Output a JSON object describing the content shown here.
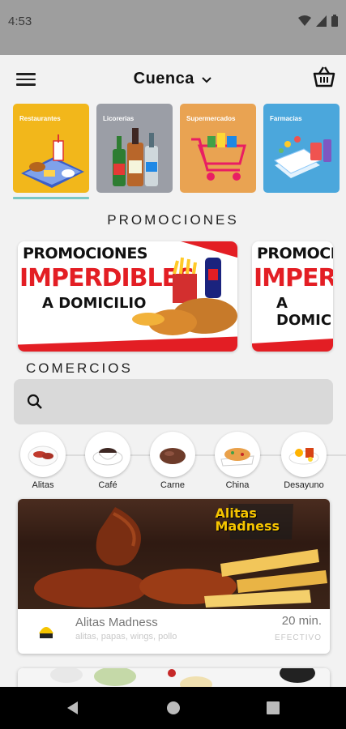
{
  "status": {
    "time": "4:53"
  },
  "header": {
    "city": "Cuenca"
  },
  "categories": [
    {
      "label": "Restaurantes",
      "color": "#f2b71b"
    },
    {
      "label": "Licorerias",
      "color": "#9b9ea6"
    },
    {
      "label": "Supermercados",
      "color": "#e9a352"
    },
    {
      "label": "Farmacias",
      "color": "#4ba7dc"
    }
  ],
  "promotions": {
    "title": "PROMOCIONES",
    "cards": [
      {
        "line1": "PROMOCIONES",
        "line2": "IMPERDIBLES",
        "line3": "A DOMICILIO"
      },
      {
        "line1": "PROMOCI",
        "line2": "IMPERD",
        "line3": "A DOMIC"
      }
    ]
  },
  "comercios": {
    "title": "COMERCIOS"
  },
  "food_categories": [
    {
      "label": "Alitas"
    },
    {
      "label": "Café"
    },
    {
      "label": "Carne"
    },
    {
      "label": "China"
    },
    {
      "label": "Desayuno"
    }
  ],
  "stores": [
    {
      "name": "Alitas Madness",
      "tags": "alitas, papas, wings, pollo",
      "time": "20 min.",
      "payment": "EFECTIVO",
      "logo_line1": "Alitas",
      "logo_line2": "Madness"
    }
  ],
  "colors": {
    "accent": "#7ac7c4",
    "promo_red": "#e31e24"
  }
}
